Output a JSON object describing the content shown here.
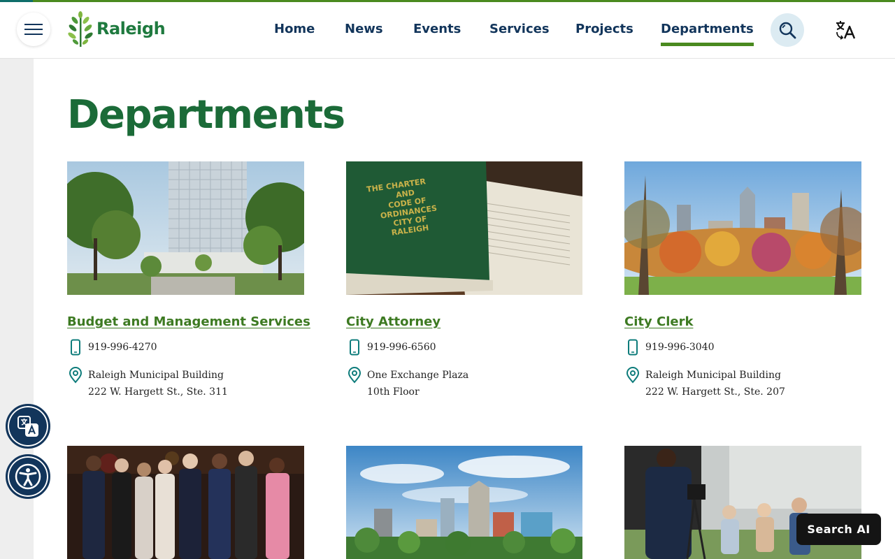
{
  "header": {
    "logo_text": "Raleigh",
    "nav": [
      {
        "label": "Home"
      },
      {
        "label": "News"
      },
      {
        "label": "Events"
      },
      {
        "label": "Services"
      },
      {
        "label": "Projects"
      },
      {
        "label": "Departments",
        "active": true
      }
    ]
  },
  "page": {
    "title": "Departments"
  },
  "departments": [
    {
      "name": "Budget and Management Services",
      "phone": "919-996-4270",
      "address_line1": "Raleigh Municipal Building",
      "address_line2": "222 W. Hargett St., Ste. 311",
      "image": "building-rendering"
    },
    {
      "name": "City Attorney",
      "phone": "919-996-6560",
      "address_line1": "One Exchange Plaza",
      "address_line2": "10th Floor",
      "image": "charter-book"
    },
    {
      "name": "City Clerk",
      "phone": "919-996-3040",
      "address_line1": "Raleigh Municipal Building",
      "address_line2": "222 W. Hargett St., Ste. 207",
      "image": "skyline-autumn"
    },
    {
      "image": "council-group-photo"
    },
    {
      "image": "skyline-summer"
    },
    {
      "image": "video-interview"
    }
  ],
  "widgets": {
    "search_ai_label": "Search AI"
  },
  "colors": {
    "brand_green": "#1b6b38",
    "link_green": "#3d7a22",
    "nav_blue": "#12355b",
    "accent_bar": "#4a8a1f"
  }
}
